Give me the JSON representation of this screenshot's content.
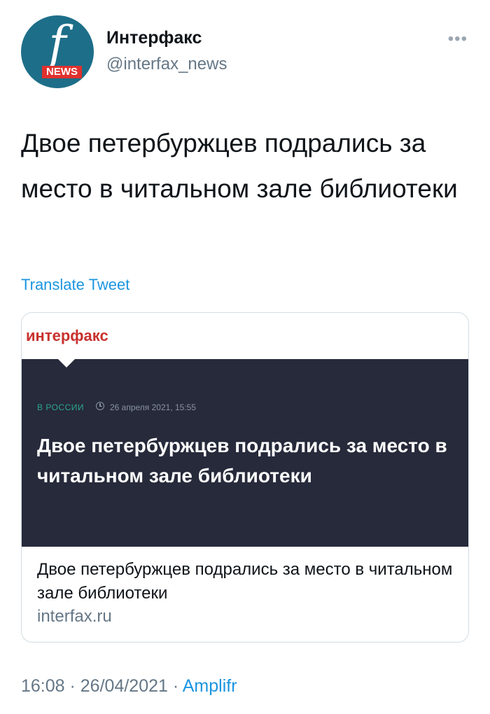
{
  "author": {
    "name": "Интерфакс",
    "handle": "@interfax_news",
    "avatar_letter": "f",
    "avatar_badge": "NEWS",
    "avatar_color": "#1d6e89",
    "badge_color": "#e0312e"
  },
  "more_icon": "more-dots-icon",
  "tweet": {
    "text": "Двое петербуржцев подрались за место в читальном зале библиотеки",
    "translate_label": "Translate Tweet"
  },
  "card": {
    "logo": "интерфакс",
    "rubric": "В России",
    "date": "26 апреля 2021, 15:55",
    "headline": "Двое петербуржцев подрались за место в читальном зале библиотеки",
    "title": "Двое петербуржцев подрались за место в читальном зале библиотеки",
    "domain": "interfax.ru",
    "dark_bg": "#262a3a",
    "logo_color": "#c8312e",
    "rubric_color": "#2ea68c"
  },
  "meta": {
    "time": "16:08",
    "separator": " · ",
    "date": "26/04/2021",
    "source": "Amplifr"
  },
  "colors": {
    "link": "#1b95e0",
    "secondary": "#657786"
  }
}
